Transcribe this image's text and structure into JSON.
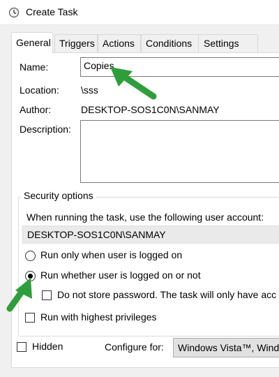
{
  "window": {
    "title": "Create Task",
    "icon": "task-scheduler-icon"
  },
  "tabs": [
    {
      "label": "General",
      "active": true
    },
    {
      "label": "Triggers",
      "active": false
    },
    {
      "label": "Actions",
      "active": false
    },
    {
      "label": "Conditions",
      "active": false
    },
    {
      "label": "Settings",
      "active": false
    }
  ],
  "general": {
    "name_label": "Name:",
    "name_value": "Copies",
    "location_label": "Location:",
    "location_value": "\\sss",
    "author_label": "Author:",
    "author_value": "DESKTOP-SOS1C0N\\SANMAY",
    "description_label": "Description:",
    "description_value": ""
  },
  "security": {
    "group_title": "Security options",
    "prompt": "When running the task, use the following user account:",
    "account": "DESKTOP-SOS1C0N\\SANMAY",
    "radio_logged_on": "Run only when user is logged on",
    "radio_whether": "Run whether user is logged on or not",
    "selected_radio": "whether",
    "no_store_password": "Do not store password.  The task will only have acc",
    "highest_privileges": "Run with highest privileges"
  },
  "bottom": {
    "hidden_label": "Hidden",
    "configure_label": "Configure for:",
    "configure_value": "Windows Vista™, Windo"
  },
  "colors": {
    "annotation_arrow": "#2e9e3a",
    "selected_tab_bg": "#ffffff"
  }
}
